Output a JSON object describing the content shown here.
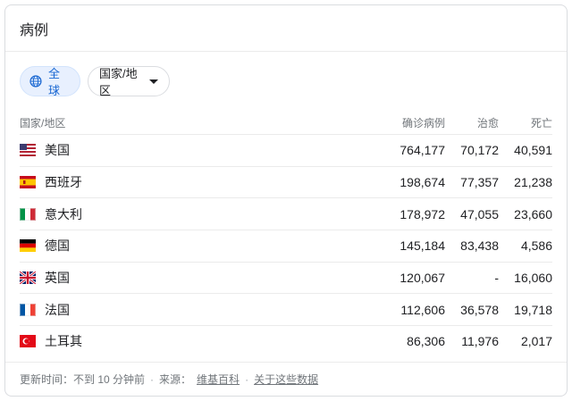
{
  "card": {
    "title": "病例"
  },
  "filters": {
    "global_label": "全球",
    "region_label": "国家/地区"
  },
  "table": {
    "headers": {
      "name": "国家/地区",
      "confirmed": "确诊病例",
      "recovered": "治愈",
      "deaths": "死亡"
    },
    "rows": [
      {
        "flag": "us-flag-icon",
        "name": "美国",
        "confirmed": "764,177",
        "recovered": "70,172",
        "deaths": "40,591"
      },
      {
        "flag": "spain-flag-icon",
        "name": "西班牙",
        "confirmed": "198,674",
        "recovered": "77,357",
        "deaths": "21,238"
      },
      {
        "flag": "italy-flag-icon",
        "name": "意大利",
        "confirmed": "178,972",
        "recovered": "47,055",
        "deaths": "23,660"
      },
      {
        "flag": "germany-flag-icon",
        "name": "德国",
        "confirmed": "145,184",
        "recovered": "83,438",
        "deaths": "4,586"
      },
      {
        "flag": "uk-flag-icon",
        "name": "英国",
        "confirmed": "120,067",
        "recovered": "-",
        "deaths": "16,060"
      },
      {
        "flag": "france-flag-icon",
        "name": "法国",
        "confirmed": "112,606",
        "recovered": "36,578",
        "deaths": "19,718"
      },
      {
        "flag": "turkey-flag-icon",
        "name": "土耳其",
        "confirmed": "86,306",
        "recovered": "11,976",
        "deaths": "2,017"
      }
    ]
  },
  "footer": {
    "updated": "更新时间：不到 10 分钟前",
    "source_prefix": "来源：",
    "source_link": "维基百科",
    "about_link": "关于这些数据"
  },
  "colors": {
    "accent": "#1967d2",
    "chip_bg": "#e8f0fe",
    "border": "#dadce0",
    "muted": "#70757a"
  }
}
